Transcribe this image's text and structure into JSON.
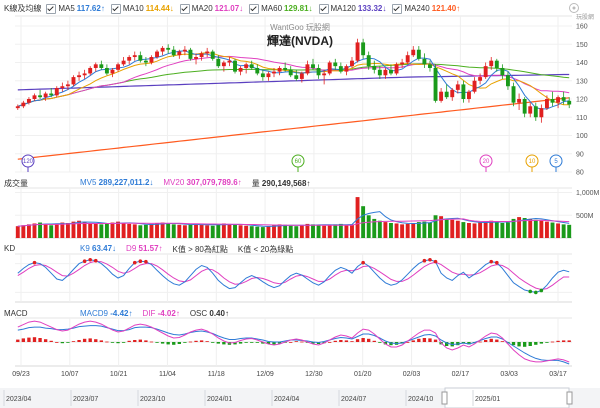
{
  "main_legend": {
    "title": "K線及均線",
    "items": [
      {
        "id": "ma5",
        "label": "MA5",
        "value": "117.62",
        "arrow": "↑",
        "color": "#2e7bd6",
        "checked": true
      },
      {
        "id": "ma10",
        "label": "MA10",
        "value": "114.44",
        "arrow": "↓",
        "color": "#e8a200",
        "checked": true
      },
      {
        "id": "ma20",
        "label": "MA20",
        "value": "121.07",
        "arrow": "↓",
        "color": "#e040c0",
        "checked": true
      },
      {
        "id": "ma60",
        "label": "MA60",
        "value": "129.81",
        "arrow": "↓",
        "color": "#4caf20",
        "checked": true
      },
      {
        "id": "ma120",
        "label": "MA120",
        "value": "133.32",
        "arrow": "↓",
        "color": "#5a3fc0",
        "checked": true
      },
      {
        "id": "ma240",
        "label": "MA240",
        "value": "121.40",
        "arrow": "↑",
        "color": "#ff5a1f",
        "checked": true
      }
    ]
  },
  "chart_header": {
    "watermark": "WantGoo 玩股網",
    "title": "輝達(NVDA)"
  },
  "markers": [
    {
      "label": "120",
      "color": "#5a3fc0"
    },
    {
      "label": "60",
      "color": "#4caf20"
    },
    {
      "label": "20",
      "color": "#e040c0"
    },
    {
      "label": "10",
      "color": "#e8a200"
    },
    {
      "label": "5",
      "color": "#2e7bd6"
    }
  ],
  "volume_legend": {
    "title": "成交量",
    "items": [
      {
        "label": "MV5",
        "value": "289,227,011.2",
        "arrow": "↓",
        "color": "#2e7bd6"
      },
      {
        "label": "MV20",
        "value": "307,079,789.6",
        "arrow": "↑",
        "color": "#e040c0"
      },
      {
        "label": "量",
        "value": "290,149,568",
        "arrow": "↑",
        "color": "#333333"
      }
    ]
  },
  "kd_legend": {
    "title": "KD",
    "items": [
      {
        "label": "K9",
        "value": "63.47",
        "arrow": "↓",
        "color": "#2e7bd6"
      },
      {
        "label": "D9",
        "value": "51.57",
        "arrow": "↑",
        "color": "#e040c0"
      },
      {
        "label": "K值 > 80為紅點",
        "value": "",
        "arrow": "",
        "color": "#333333"
      },
      {
        "label": "K值 < 20為綠點",
        "value": "",
        "arrow": "",
        "color": "#333333"
      }
    ]
  },
  "macd_legend": {
    "title": "MACD",
    "items": [
      {
        "label": "MACD9",
        "value": "-4.42",
        "arrow": "↑",
        "color": "#2e7bd6"
      },
      {
        "label": "DIF",
        "value": "-4.02",
        "arrow": "↑",
        "color": "#e040c0"
      },
      {
        "label": "OSC",
        "value": "0.40",
        "arrow": "↑",
        "color": "#333333"
      }
    ]
  },
  "navigator": {
    "labels": [
      "2023/04",
      "2023/07",
      "2023/10",
      "2024/01",
      "2024/04",
      "2024/07",
      "2024/10",
      "2025/01"
    ]
  },
  "logo": {
    "text": "玩股網"
  },
  "chart_data": [
    {
      "type": "candlestick",
      "title": "輝達(NVDA)",
      "x_tick_labels": [
        "09/23",
        "10/07",
        "10/21",
        "11/04",
        "11/18",
        "12/09",
        "12/30",
        "01/20",
        "02/03",
        "02/17",
        "03/03",
        "03/17"
      ],
      "ylim": [
        80,
        160
      ],
      "y_ticks": [
        160,
        150,
        140,
        130,
        120,
        110,
        100,
        90,
        80
      ],
      "ohlc": [
        [
          115,
          117,
          114,
          116
        ],
        [
          116,
          119,
          115,
          118
        ],
        [
          118,
          121,
          117,
          120
        ],
        [
          120,
          123,
          119,
          122
        ],
        [
          122,
          125,
          120,
          121
        ],
        [
          121,
          124,
          119,
          123
        ],
        [
          123,
          126,
          121,
          122
        ],
        [
          122,
          127,
          121,
          126
        ],
        [
          126,
          129,
          124,
          127
        ],
        [
          127,
          130,
          125,
          128
        ],
        [
          128,
          133,
          127,
          132
        ],
        [
          132,
          135,
          130,
          133
        ],
        [
          133,
          136,
          131,
          134
        ],
        [
          134,
          138,
          133,
          137
        ],
        [
          137,
          140,
          135,
          139
        ],
        [
          139,
          141,
          136,
          137
        ],
        [
          137,
          139,
          133,
          134
        ],
        [
          134,
          137,
          132,
          136
        ],
        [
          136,
          140,
          135,
          139
        ],
        [
          139,
          143,
          138,
          141
        ],
        [
          141,
          144,
          139,
          143
        ],
        [
          143,
          146,
          141,
          144
        ],
        [
          144,
          146,
          140,
          141
        ],
        [
          141,
          143,
          138,
          140
        ],
        [
          140,
          144,
          139,
          143
        ],
        [
          143,
          147,
          142,
          146
        ],
        [
          146,
          149,
          144,
          148
        ],
        [
          148,
          150,
          145,
          147
        ],
        [
          147,
          149,
          143,
          144
        ],
        [
          144,
          147,
          142,
          146
        ],
        [
          146,
          149,
          144,
          147
        ],
        [
          147,
          148,
          141,
          142
        ],
        [
          142,
          145,
          139,
          143
        ],
        [
          143,
          146,
          141,
          145
        ],
        [
          145,
          148,
          143,
          146
        ],
        [
          146,
          147,
          141,
          142
        ],
        [
          142,
          144,
          137,
          138
        ],
        [
          138,
          141,
          135,
          140
        ],
        [
          140,
          143,
          138,
          141
        ],
        [
          141,
          142,
          134,
          135
        ],
        [
          135,
          138,
          133,
          137
        ],
        [
          137,
          140,
          134,
          139
        ],
        [
          139,
          141,
          136,
          137
        ],
        [
          137,
          139,
          133,
          134
        ],
        [
          134,
          136,
          130,
          132
        ],
        [
          132,
          135,
          130,
          134
        ],
        [
          134,
          137,
          132,
          135
        ],
        [
          135,
          138,
          133,
          137
        ],
        [
          137,
          140,
          135,
          136
        ],
        [
          136,
          138,
          132,
          133
        ],
        [
          133,
          136,
          130,
          131
        ],
        [
          131,
          135,
          129,
          134
        ],
        [
          134,
          141,
          133,
          139
        ],
        [
          139,
          142,
          136,
          137
        ],
        [
          137,
          139,
          131,
          133
        ],
        [
          133,
          136,
          128,
          134
        ],
        [
          134,
          141,
          133,
          140
        ],
        [
          140,
          142,
          136,
          138
        ],
        [
          138,
          140,
          134,
          135
        ],
        [
          135,
          139,
          133,
          138
        ],
        [
          138,
          143,
          137,
          141
        ],
        [
          141,
          153,
          140,
          151
        ],
        [
          151,
          153,
          142,
          144
        ],
        [
          144,
          146,
          136,
          138
        ],
        [
          138,
          141,
          134,
          136
        ],
        [
          136,
          138,
          131,
          133
        ],
        [
          133,
          137,
          131,
          136
        ],
        [
          136,
          139,
          133,
          134
        ],
        [
          134,
          140,
          133,
          139
        ],
        [
          139,
          142,
          137,
          140
        ],
        [
          140,
          146,
          139,
          144
        ],
        [
          144,
          149,
          143,
          147
        ],
        [
          147,
          149,
          141,
          142
        ],
        [
          142,
          145,
          137,
          139
        ],
        [
          139,
          141,
          135,
          137
        ],
        [
          137,
          139,
          118,
          119
        ],
        [
          119,
          126,
          118,
          124
        ],
        [
          124,
          128,
          120,
          121
        ],
        [
          121,
          126,
          119,
          125
        ],
        [
          125,
          130,
          123,
          128
        ],
        [
          128,
          130,
          118,
          120
        ],
        [
          120,
          125,
          118,
          124
        ],
        [
          124,
          132,
          123,
          130
        ],
        [
          130,
          134,
          128,
          132
        ],
        [
          132,
          140,
          131,
          138
        ],
        [
          138,
          143,
          136,
          141
        ],
        [
          141,
          142,
          135,
          137
        ],
        [
          137,
          139,
          131,
          133
        ],
        [
          133,
          135,
          125,
          127
        ],
        [
          127,
          129,
          116,
          118
        ],
        [
          118,
          123,
          114,
          120
        ],
        [
          120,
          121,
          110,
          112
        ],
        [
          112,
          118,
          110,
          116
        ],
        [
          116,
          118,
          108,
          110
        ],
        [
          110,
          117,
          107,
          115
        ],
        [
          115,
          122,
          114,
          120
        ],
        [
          120,
          124,
          116,
          118
        ],
        [
          118,
          122,
          115,
          121
        ],
        [
          121,
          124,
          117,
          119
        ],
        [
          119,
          121,
          115,
          117
        ]
      ]
    },
    {
      "type": "bar",
      "title": "成交量",
      "y_ticks": [
        "1,000M",
        "500M"
      ],
      "values_millions": [
        260,
        280,
        300,
        320,
        340,
        300,
        280,
        320,
        340,
        330,
        360,
        380,
        350,
        330,
        310,
        300,
        320,
        340,
        360,
        330,
        310,
        300,
        280,
        290,
        310,
        330,
        340,
        320,
        300,
        290,
        280,
        300,
        310,
        290,
        280,
        270,
        300,
        320,
        310,
        290,
        280,
        270,
        260,
        250,
        240,
        260,
        280,
        300,
        290,
        270,
        260,
        280,
        310,
        300,
        290,
        270,
        280,
        300,
        310,
        290,
        300,
        900,
        700,
        500,
        420,
        380,
        350,
        330,
        320,
        300,
        310,
        330,
        350,
        360,
        340,
        500,
        480,
        420,
        400,
        380,
        350,
        330,
        320,
        340,
        360,
        380,
        350,
        330,
        340,
        420,
        460,
        440,
        420,
        400,
        380,
        360,
        340,
        320,
        300,
        290
      ],
      "ylim": [
        0,
        1100
      ]
    },
    {
      "type": "line",
      "title": "KD",
      "ylim": [
        0,
        100
      ],
      "k": [
        60,
        70,
        78,
        82,
        80,
        72,
        60,
        48,
        45,
        55,
        68,
        80,
        85,
        88,
        86,
        80,
        70,
        58,
        50,
        55,
        70,
        82,
        85,
        84,
        78,
        66,
        55,
        45,
        38,
        35,
        42,
        55,
        68,
        76,
        72,
        60,
        45,
        35,
        28,
        30,
        40,
        50,
        55,
        50,
        42,
        35,
        30,
        34,
        45,
        55,
        60,
        56,
        48,
        40,
        35,
        42,
        55,
        66,
        72,
        68,
        60,
        74,
        82,
        75,
        62,
        50,
        40,
        35,
        38,
        46,
        58,
        70,
        80,
        86,
        88,
        84,
        60,
        50,
        45,
        55,
        62,
        50,
        58,
        68,
        78,
        84,
        82,
        70,
        55,
        40,
        32,
        25,
        22,
        20,
        24,
        35,
        50,
        62,
        66,
        63
      ],
      "d": [
        55,
        62,
        70,
        76,
        78,
        76,
        70,
        62,
        55,
        54,
        60,
        68,
        76,
        82,
        85,
        84,
        79,
        72,
        64,
        60,
        63,
        70,
        77,
        80,
        80,
        75,
        67,
        58,
        50,
        44,
        42,
        46,
        55,
        64,
        69,
        67,
        60,
        50,
        42,
        37,
        38,
        43,
        49,
        51,
        49,
        45,
        40,
        38,
        41,
        48,
        54,
        56,
        53,
        48,
        43,
        43,
        48,
        56,
        63,
        66,
        65,
        68,
        74,
        75,
        70,
        63,
        55,
        47,
        43,
        43,
        48,
        56,
        65,
        74,
        80,
        83,
        78,
        70,
        62,
        58,
        58,
        56,
        57,
        61,
        68,
        75,
        78,
        76,
        70,
        60,
        50,
        42,
        35,
        29,
        26,
        28,
        35,
        44,
        52,
        52
      ]
    },
    {
      "type": "bar",
      "title": "MACD",
      "osc": [
        0.6,
        0.9,
        1.1,
        1.2,
        1.0,
        0.7,
        0.3,
        0.0,
        -0.3,
        -0.2,
        0.2,
        0.5,
        0.8,
        0.9,
        0.7,
        0.4,
        0.1,
        -0.2,
        -0.3,
        -0.1,
        0.3,
        0.5,
        0.6,
        0.4,
        0.1,
        -0.2,
        -0.4,
        -0.6,
        -0.7,
        -0.5,
        -0.2,
        0.1,
        0.3,
        0.4,
        0.2,
        -0.1,
        -0.4,
        -0.6,
        -0.7,
        -0.6,
        -0.4,
        -0.2,
        -0.1,
        -0.2,
        -0.4,
        -0.5,
        -0.6,
        -0.4,
        -0.2,
        0.0,
        0.2,
        0.1,
        -0.2,
        -0.4,
        -0.5,
        -0.3,
        0.0,
        0.3,
        0.5,
        0.4,
        0.2,
        0.7,
        1.0,
        0.8,
        0.3,
        -0.2,
        -0.6,
        -0.8,
        -0.7,
        -0.4,
        0.0,
        0.4,
        0.8,
        1.0,
        0.9,
        0.6,
        -0.6,
        -1.0,
        -1.1,
        -0.8,
        -0.4,
        -0.6,
        -0.3,
        0.1,
        0.5,
        0.8,
        0.6,
        0.2,
        -0.3,
        -0.8,
        -1.1,
        -1.2,
        -1.0,
        -0.7,
        -0.4,
        -0.1,
        0.1,
        0.3,
        0.4,
        0.4
      ],
      "dif": [
        3,
        3.5,
        4,
        4.2,
        4,
        3.5,
        3,
        2.5,
        2.2,
        2.4,
        3,
        3.6,
        4,
        4.2,
        4,
        3.6,
        3,
        2.4,
        2,
        2.2,
        2.8,
        3.4,
        3.6,
        3.4,
        3,
        2.4,
        1.8,
        1.2,
        0.8,
        0.9,
        1.4,
        2,
        2.4,
        2.6,
        2.2,
        1.6,
        0.8,
        0.2,
        -0.2,
        -0.1,
        0.3,
        0.6,
        0.7,
        0.4,
        0,
        -0.4,
        -0.6,
        -0.4,
        0,
        0.4,
        0.6,
        0.4,
        0,
        -0.4,
        -0.6,
        -0.2,
        0.4,
        1,
        1.4,
        1.2,
        0.8,
        1.8,
        2.6,
        2.4,
        1.6,
        0.6,
        -0.4,
        -1,
        -1,
        -0.6,
        0.2,
        1,
        1.8,
        2.4,
        2.4,
        1.8,
        -0.2,
        -1.2,
        -1.6,
        -1.2,
        -0.6,
        -1,
        -0.4,
        0.4,
        1.2,
        1.8,
        1.6,
        0.8,
        -0.4,
        -1.6,
        -2.6,
        -3.4,
        -3.8,
        -4,
        -4,
        -3.8,
        -3.6,
        -3.4,
        -3.6,
        -4.02
      ],
      "macd": [
        2.4,
        2.6,
        2.9,
        3.0,
        3.0,
        2.8,
        2.7,
        2.5,
        2.5,
        2.6,
        2.8,
        3.1,
        3.2,
        3.3,
        3.3,
        3.2,
        2.9,
        2.6,
        2.3,
        2.3,
        2.5,
        2.9,
        3.0,
        3.0,
        2.9,
        2.6,
        2.2,
        1.8,
        1.5,
        1.4,
        1.6,
        1.9,
        2.1,
        2.2,
        2.0,
        1.7,
        1.2,
        0.8,
        0.5,
        0.5,
        0.7,
        0.8,
        0.8,
        0.6,
        0.4,
        0.1,
        0.0,
        0.0,
        0.2,
        0.4,
        0.4,
        0.3,
        0.2,
        0.0,
        -0.1,
        0.1,
        0.4,
        0.7,
        0.9,
        0.8,
        0.6,
        1.1,
        1.6,
        1.6,
        1.3,
        0.8,
        0.2,
        -0.2,
        -0.3,
        -0.2,
        0.2,
        0.6,
        1.0,
        1.4,
        1.5,
        1.2,
        0.4,
        -0.2,
        -0.5,
        -0.4,
        -0.2,
        -0.4,
        -0.1,
        0.3,
        0.7,
        1.0,
        1.0,
        0.6,
        -0.1,
        -0.8,
        -1.5,
        -2.2,
        -2.8,
        -3.3,
        -3.6,
        -3.7,
        -3.7,
        -3.7,
        -4.0,
        -4.42
      ]
    }
  ]
}
